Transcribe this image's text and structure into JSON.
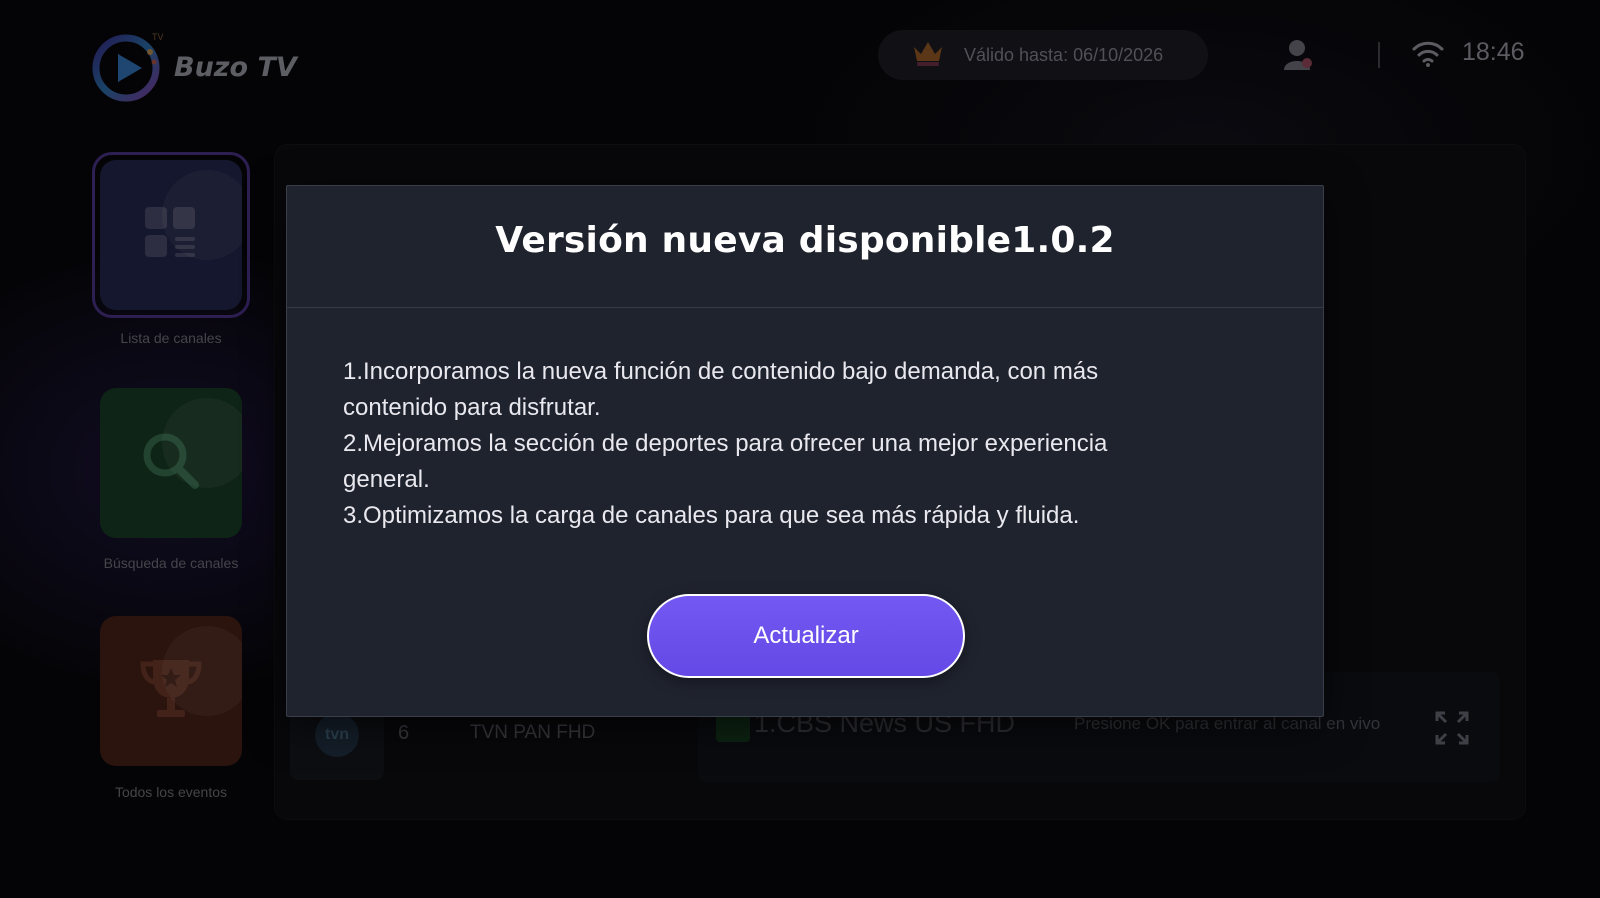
{
  "app": {
    "name": "Buzo TV",
    "logo_sup": "TV"
  },
  "header": {
    "subscription": "Válido hasta: 06/10/2026",
    "time": "18:46"
  },
  "sidebar": {
    "items": [
      {
        "label": "Lista de canales",
        "icon": "grid-list-icon",
        "color": "#1b1f3d",
        "selected": true
      },
      {
        "label": "Búsqueda de canales",
        "icon": "search-icon",
        "color": "#13301f",
        "selected": false
      },
      {
        "label": "Todos los eventos",
        "icon": "trophy-icon",
        "color": "#3a1b12",
        "selected": false
      }
    ]
  },
  "background_channel": {
    "number": "6",
    "name": "TVN PAN FHD",
    "thumb_text": "tvn",
    "now_playing": "1.CBS News US FHD",
    "hint": "Presione OK para entrar al canal en vivo"
  },
  "modal": {
    "title": "Versión nueva disponible1.0.2",
    "lines": [
      "1.Incorporamos la nueva función de contenido bajo demanda, con más",
      "contenido para disfrutar.",
      "2.Mejoramos la sección de deportes para ofrecer una mejor experiencia",
      "general.",
      "3.Optimizamos la carga de canales para que sea más rápida y fluida."
    ],
    "button": "Actualizar"
  },
  "colors": {
    "accent": "#6b4ff0",
    "modal_bg": "#1f232e",
    "background": "#060609"
  }
}
